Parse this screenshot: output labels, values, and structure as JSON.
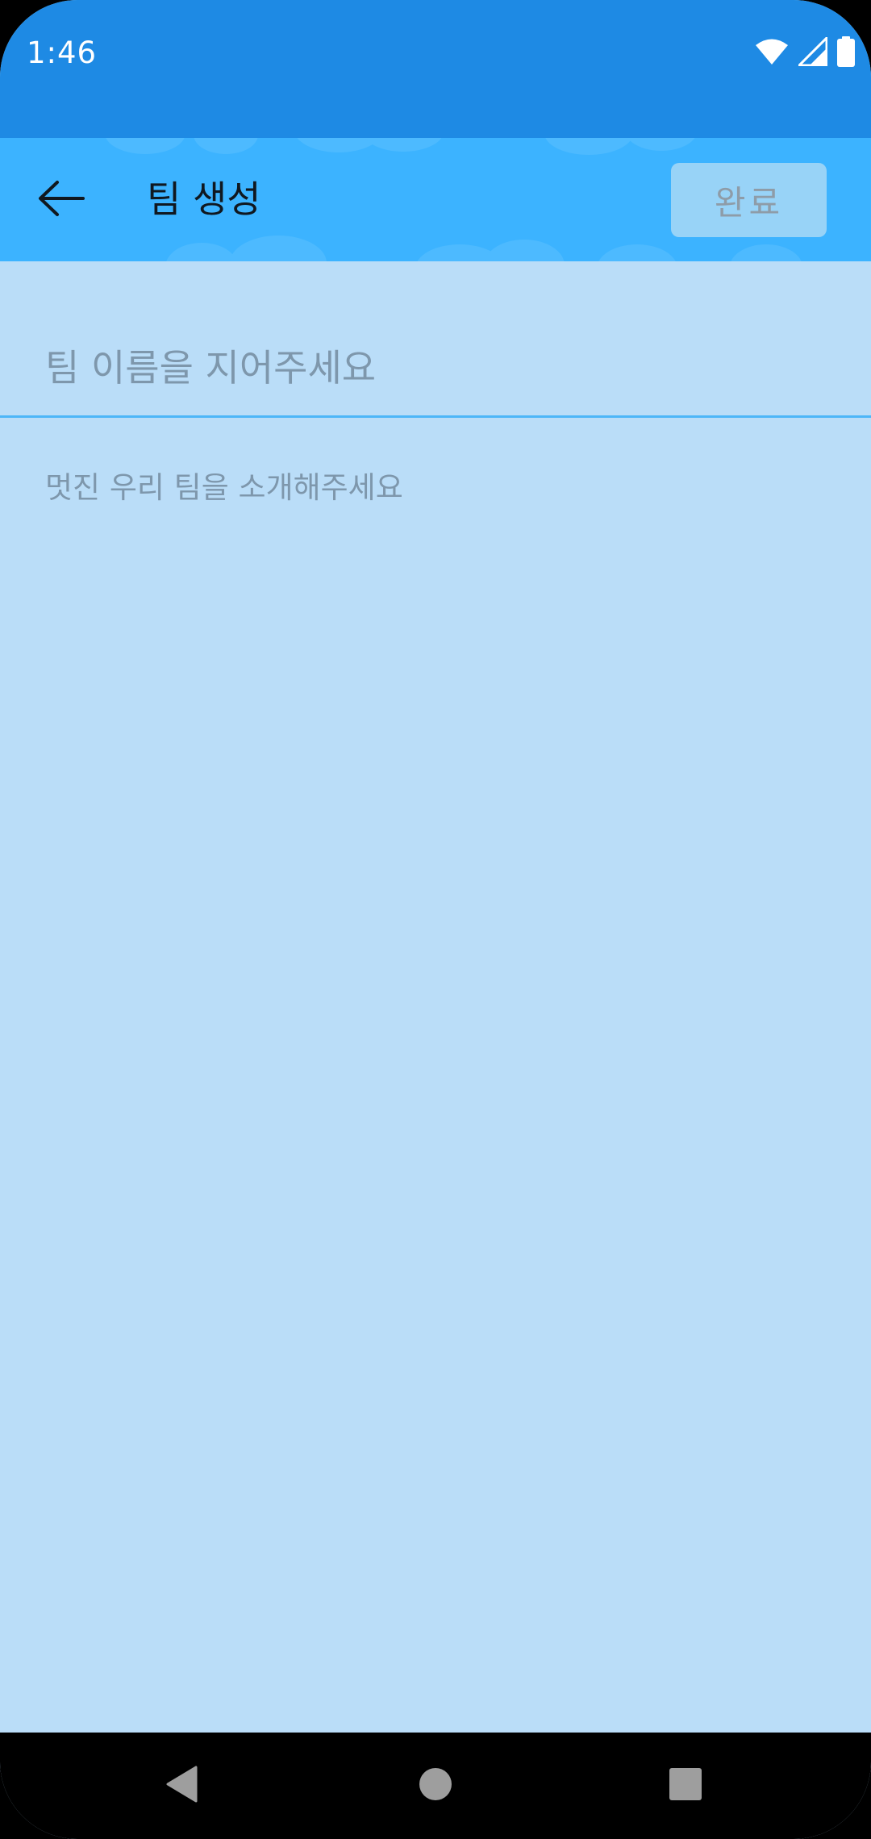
{
  "status_bar": {
    "time": "1:46",
    "icons": [
      "wifi-icon",
      "signal-icon",
      "battery-icon"
    ]
  },
  "app_bar": {
    "back_icon": "arrow-left-icon",
    "title": "팀 생성",
    "done_label": "완료"
  },
  "form": {
    "team_name": {
      "value": "",
      "placeholder": "팀 이름을 지어주세요"
    },
    "team_intro": {
      "value": "",
      "placeholder": "멋진 우리 팀을 소개해주세요"
    }
  },
  "nav_bar": {
    "buttons": [
      "back-triangle-icon",
      "home-circle-icon",
      "recents-square-icon"
    ]
  },
  "colors": {
    "status_bar": "#1E8AE4",
    "app_bar": "#3CB3FF",
    "background": "#BADDF8",
    "input_underline": "#4DB6F8",
    "placeholder_text": "#7E97AC"
  }
}
